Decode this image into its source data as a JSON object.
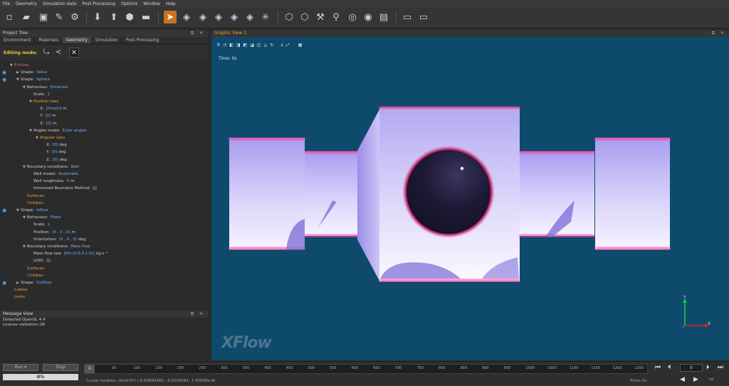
{
  "menu": [
    "File",
    "Geometry",
    "Simulation data",
    "Post-Processing",
    "Options",
    "Window",
    "Help"
  ],
  "project_tree": {
    "title": "Project Tree",
    "tabs": [
      "Environment",
      "Materials",
      "Geometry",
      "Simulation",
      "Post-Processing"
    ],
    "active_tab": "Geometry",
    "editing_mode_label": "Editing mode:",
    "rows": [
      {
        "indent": 0,
        "tri": "▼",
        "k": "Entities",
        "style": "red"
      },
      {
        "indent": 1,
        "tri": "▶",
        "k": "Shape:",
        "v": "Valve",
        "eye": true
      },
      {
        "indent": 1,
        "tri": "▼",
        "k": "Shape:",
        "v": "Sphere",
        "eye": true
      },
      {
        "indent": 2,
        "tri": "▼",
        "k": "Behaviour:",
        "v": "Enforced"
      },
      {
        "indent": 3,
        "tri": "",
        "k": "Scale:",
        "v": "1"
      },
      {
        "indent": 3,
        "tri": "▼",
        "k": "Position laws",
        "style": "orange"
      },
      {
        "indent": 4,
        "tri": "",
        "k": "X:",
        "v": "[fmu(t)]",
        "u": "m"
      },
      {
        "indent": 4,
        "tri": "",
        "k": "Y:",
        "v": "[0]",
        "u": "m"
      },
      {
        "indent": 4,
        "tri": "",
        "k": "Z:",
        "v": "[0]",
        "u": "m"
      },
      {
        "indent": 3,
        "tri": "▼",
        "k": "Angles mode:",
        "v": "Euler angles"
      },
      {
        "indent": 4,
        "tri": "▼",
        "k": "Angular laws",
        "style": "orange"
      },
      {
        "indent": 5,
        "tri": "",
        "k": "X:",
        "v": "[0]",
        "u": "deg"
      },
      {
        "indent": 5,
        "tri": "",
        "k": "Y:",
        "v": "[0]",
        "u": "deg"
      },
      {
        "indent": 5,
        "tri": "",
        "k": "Z:",
        "v": "[0]",
        "u": "deg"
      },
      {
        "indent": 2,
        "tri": "▼",
        "k": "Boundary conditions:",
        "v": "Wall"
      },
      {
        "indent": 3,
        "tri": "",
        "k": "Wall model:",
        "v": "Automatic"
      },
      {
        "indent": 3,
        "tri": "",
        "k": "Wall roughness:",
        "v": "0",
        "u": "m"
      },
      {
        "indent": 3,
        "tri": "",
        "k": "Immersed Boundary Method:",
        "chk": true
      },
      {
        "indent": 2,
        "tri": "",
        "k": "Surfaces",
        "style": "orange"
      },
      {
        "indent": 2,
        "tri": "",
        "k": "Children",
        "style": "orange"
      },
      {
        "indent": 1,
        "tri": "▼",
        "k": "Shape:",
        "v": "Inflow",
        "eye": true
      },
      {
        "indent": 2,
        "tri": "▼",
        "k": "Behaviour:",
        "v": "Fixed"
      },
      {
        "indent": 3,
        "tri": "",
        "k": "Scale:",
        "v": "1"
      },
      {
        "indent": 3,
        "tri": "",
        "k": "Position:",
        "v": "(0 , 0 , 0)",
        "u": "m"
      },
      {
        "indent": 3,
        "tri": "",
        "k": "Orientation:",
        "v": "(0 , 0 , 0)",
        "u": "deg"
      },
      {
        "indent": 2,
        "tri": "▼",
        "k": "Boundary conditions:",
        "v": "Mass flow"
      },
      {
        "indent": 3,
        "tri": "",
        "k": "Mass flow law:",
        "v": "[if(t<0.5,0.1,0)]",
        "u": "kg·s⁻¹"
      },
      {
        "indent": 3,
        "tri": "",
        "k": "LODI:",
        "chk": true
      },
      {
        "indent": 2,
        "tri": "",
        "k": "Surfaces",
        "style": "orange"
      },
      {
        "indent": 2,
        "tri": "",
        "k": "Children",
        "style": "orange"
      },
      {
        "indent": 1,
        "tri": "▶",
        "k": "Shape:",
        "v": "Outflow",
        "eye": true
      },
      {
        "indent": 0,
        "tri": "",
        "k": "Cables",
        "style": "orange"
      },
      {
        "indent": 0,
        "tri": "",
        "k": "Joints",
        "style": "orange"
      }
    ]
  },
  "message_view": {
    "title": "Message View",
    "lines": [
      "Detected OpenGL 4.4",
      "License validation OK"
    ]
  },
  "graphic_view": {
    "title": "Graphic View 1",
    "time_label": "Time: 0s",
    "logo_text": "XFlow",
    "axis_y": "Y",
    "axis_x": "X"
  },
  "bottom": {
    "run_label": "Run",
    "stop_label": "Stop",
    "progress": "0%",
    "timeline_start": "0",
    "ticks": [
      "50",
      "100",
      "150",
      "200",
      "250",
      "300",
      "350",
      "400",
      "450",
      "500",
      "550",
      "600",
      "650",
      "700",
      "750",
      "800",
      "850",
      "900",
      "950",
      "1000",
      "1050",
      "1100",
      "1150",
      "1200",
      "1250"
    ],
    "cursor_location": "Cursor location:   (Grid-XY) (-0.00894281, -0.0294281, 7.45058e-9)",
    "time_right": "Time: 0s",
    "frame_value": "0"
  }
}
